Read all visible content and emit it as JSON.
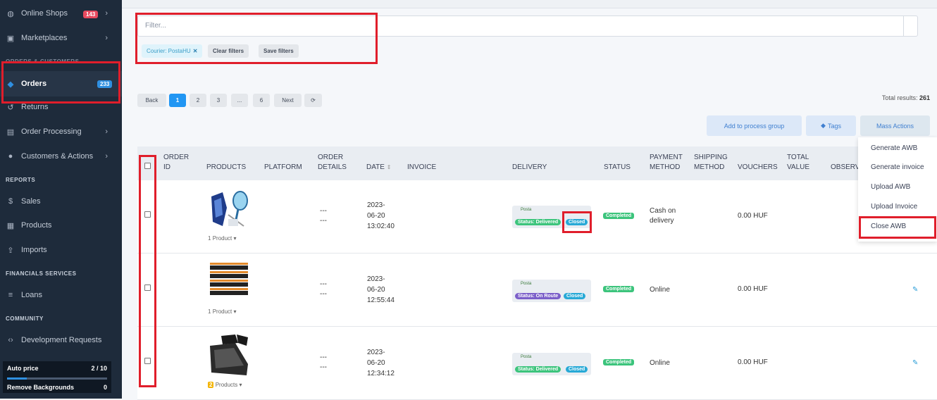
{
  "sidebar": {
    "online_shops": {
      "label": "Online Shops",
      "badge": "143"
    },
    "marketplaces": {
      "label": "Marketplaces"
    },
    "section_orders": "ORDERS & CUSTOMERS",
    "orders": {
      "label": "Orders",
      "badge": "233"
    },
    "returns": {
      "label": "Returns"
    },
    "order_processing": {
      "label": "Order Processing"
    },
    "customers": {
      "label": "Customers & Actions"
    },
    "section_reports": "REPORTS",
    "sales": {
      "label": "Sales"
    },
    "products": {
      "label": "Products"
    },
    "imports": {
      "label": "Imports"
    },
    "section_financials": "FINANCIALS SERVICES",
    "loans": {
      "label": "Loans"
    },
    "section_community": "COMMUNITY",
    "dev_requests": {
      "label": "Development Requests"
    },
    "auto_price": {
      "label": "Auto price",
      "value": "2 / 10",
      "progress": 0.2
    },
    "remove_bg": {
      "label": "Remove Backgrounds",
      "value": "0"
    }
  },
  "filter": {
    "placeholder": "Filter...",
    "courier_chip": "Courier: PostaHU",
    "chip_remove": "✕",
    "clear": "Clear filters",
    "save": "Save filters"
  },
  "pagination": {
    "back": "Back",
    "pages": [
      "1",
      "2",
      "3",
      "...",
      "6"
    ],
    "next": "Next",
    "refresh": "⟳"
  },
  "total": {
    "label": "Total results:",
    "value": "261"
  },
  "actions": {
    "process_group": "Add to process group",
    "tags": "Tags",
    "mass": "Mass Actions"
  },
  "mass_menu": [
    "Generate AWB",
    "Generate invoice",
    "Upload AWB",
    "Upload Invoice",
    "Close AWB"
  ],
  "columns": {
    "order_id": [
      "ORDER",
      "ID"
    ],
    "products": "PRODUCTS",
    "platform": "PLATFORM",
    "order_details": [
      "ORDER",
      "DETAILS"
    ],
    "date": "DATE",
    "invoice": "INVOICE",
    "delivery": "DELIVERY",
    "status": "STATUS",
    "payment": [
      "PAYMENT",
      "METHOD"
    ],
    "shipping": [
      "SHIPPING",
      "METHOD"
    ],
    "vouchers": "VOUCHERS",
    "total_value": [
      "TOTAL",
      "VALUE"
    ],
    "observations": "OBSERV"
  },
  "rows": [
    {
      "product_count": "1",
      "product_label": "Product",
      "details": [
        "---",
        "---"
      ],
      "date": [
        "2023-",
        "06-20",
        "13:02:40"
      ],
      "courier_logo": "Posta",
      "delivery_status": "Status: Delivered",
      "delivery_closed": "Closed",
      "status": "Completed",
      "payment": [
        "Cash on",
        "delivery"
      ],
      "vouchers": "0.00 HUF"
    },
    {
      "product_count": "1",
      "product_label": "Product",
      "details": [
        "---",
        "---"
      ],
      "date": [
        "2023-",
        "06-20",
        "12:55:44"
      ],
      "courier_logo": "Posta",
      "delivery_status": "Status: On Route",
      "delivery_closed": "Closed",
      "status": "Completed",
      "payment": [
        "Online",
        ""
      ],
      "vouchers": "0.00 HUF"
    },
    {
      "product_count": "2",
      "product_label": "Products",
      "details": [
        "---",
        "---"
      ],
      "date": [
        "2023-",
        "06-20",
        "12:34:12"
      ],
      "courier_logo": "Posta",
      "delivery_status": "Status: Delivered",
      "delivery_closed": "Closed",
      "status": "Completed",
      "payment": [
        "Online",
        ""
      ],
      "vouchers": "0.00 HUF"
    }
  ],
  "colors": {
    "sidebar_bg": "#1e2b3b",
    "accent_blue": "#2196f3",
    "highlight_red": "#e01e2b",
    "delivered_green": "#3cc47c",
    "on_route_purple": "#7b5fc9",
    "closed_blue": "#27a9d6"
  }
}
